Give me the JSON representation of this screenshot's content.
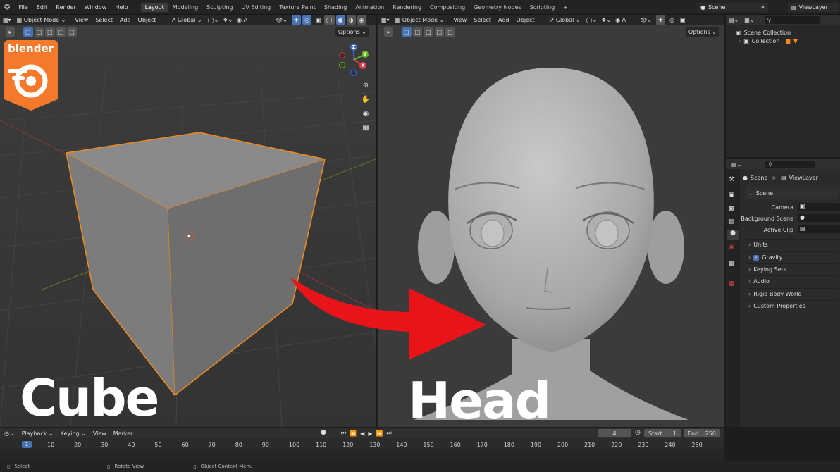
{
  "topbar": {
    "menus": [
      "File",
      "Edit",
      "Render",
      "Window",
      "Help"
    ],
    "workspaces": [
      {
        "label": "Layout",
        "active": true
      },
      {
        "label": "Modeling",
        "active": false
      },
      {
        "label": "Sculpting",
        "active": false
      },
      {
        "label": "UV Editing",
        "active": false
      },
      {
        "label": "Texture Paint",
        "active": false
      },
      {
        "label": "Shading",
        "active": false
      },
      {
        "label": "Animation",
        "active": false
      },
      {
        "label": "Rendering",
        "active": false
      },
      {
        "label": "Compositing",
        "active": false
      },
      {
        "label": "Geometry Nodes",
        "active": false
      },
      {
        "label": "Scripting",
        "active": false
      }
    ],
    "add_tab": "+",
    "scene": "Scene",
    "view_layer": "ViewLayer"
  },
  "viewport_left": {
    "mode": "Object Mode",
    "menus": [
      "View",
      "Select",
      "Add",
      "Object"
    ],
    "orientation": "Global",
    "options": "Options",
    "overlay_text": "Cube"
  },
  "viewport_right": {
    "mode": "Object Mode",
    "menus": [
      "View",
      "Select",
      "Add",
      "Object"
    ],
    "orientation": "Global",
    "options": "Options",
    "overlay_text": "Head"
  },
  "logo_text": "blender",
  "gizmo": {
    "x": "X",
    "y": "Y",
    "z": "Z"
  },
  "outliner": {
    "items": [
      {
        "label": "Scene Collection"
      },
      {
        "label": "Collection"
      }
    ]
  },
  "properties": {
    "breadcrumb_scene": "Scene",
    "breadcrumb_sep": ">",
    "breadcrumb_layer": "ViewLayer",
    "panel_scene": "Scene",
    "camera_label": "Camera",
    "bg_scene_label": "Background Scene",
    "active_clip_label": "Active Clip",
    "panels": [
      "Units",
      "Gravity",
      "Keying Sets",
      "Audio",
      "Rigid Body World",
      "Custom Properties"
    ],
    "gravity_checked": true
  },
  "timeline": {
    "menus": [
      "Playback",
      "Keying",
      "View",
      "Marker"
    ],
    "current_frame": "4",
    "start_label": "Start",
    "start_value": "1",
    "end_label": "End",
    "end_value": "250",
    "playhead": "1",
    "frame_numbers": [
      "10",
      "20",
      "30",
      "40",
      "50",
      "60",
      "70",
      "80",
      "90",
      "100",
      "110",
      "120",
      "130",
      "140",
      "150",
      "160",
      "170",
      "180",
      "190",
      "200",
      "210",
      "220",
      "230",
      "240",
      "250"
    ]
  },
  "statusbar": {
    "items": [
      "Select",
      "Rotate View",
      "Object Context Menu"
    ]
  },
  "colors": {
    "selection_orange": "#f08a1d",
    "arrow_red": "#e8141a",
    "accent_blue": "#4772b3",
    "logo_orange": "#f5792a"
  }
}
